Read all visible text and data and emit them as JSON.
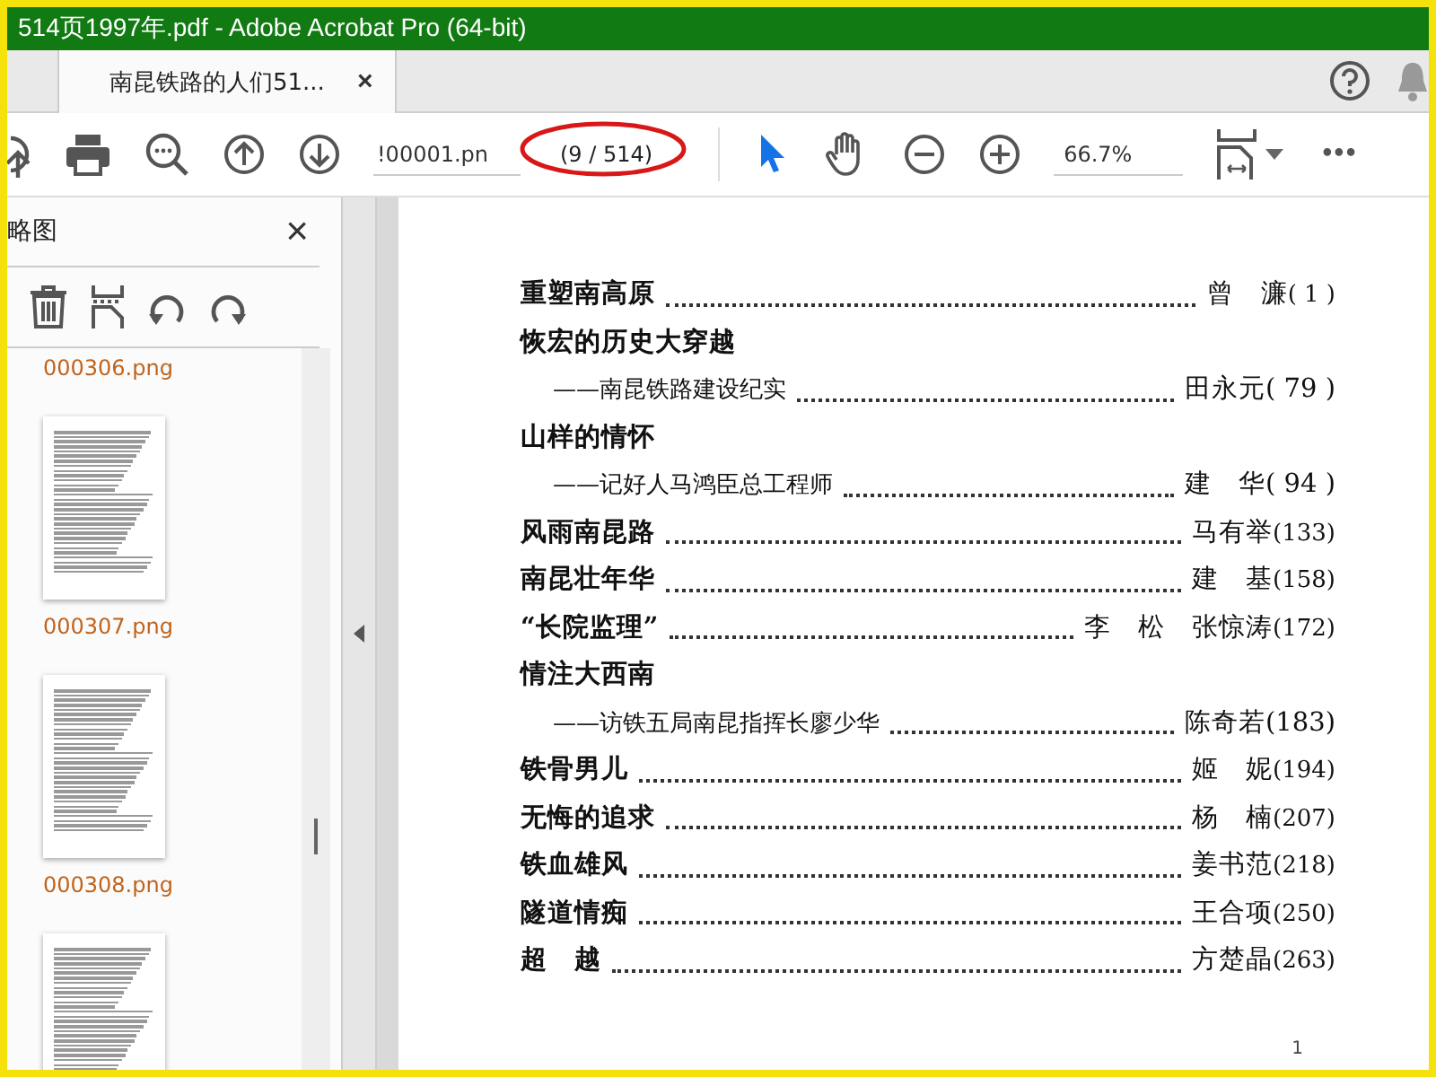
{
  "window": {
    "title": "514页1997年.pdf - Adobe Acrobat Pro (64-bit)"
  },
  "tabs": [
    {
      "label": "南昆铁路的人们51...",
      "selected": true,
      "close": "×"
    }
  ],
  "toolbar": {
    "page_field": "!00001.pn",
    "page_count": "(9 / 514)",
    "zoom": "66.7%",
    "more": "•••",
    "tools": [
      {
        "kind": "select",
        "selected": true
      },
      {
        "kind": "hand",
        "selected": false
      }
    ]
  },
  "sidebar": {
    "title": "略图",
    "close": "×",
    "thumbnails": [
      {
        "kind": "label",
        "label": "000306.png"
      },
      {
        "kind": "page",
        "label": "000307.png"
      },
      {
        "kind": "page",
        "label": "000308.png"
      },
      {
        "kind": "page"
      }
    ]
  },
  "document": {
    "entries": [
      {
        "kind": "entry",
        "title": "重塑南高原",
        "author": "曾　濂",
        "page": "( 1 )"
      },
      {
        "kind": "heading",
        "title": "恢宏的历史大穿越"
      },
      {
        "kind": "sub",
        "title": "——南昆铁路建设纪实",
        "author": "田永元",
        "page": "( 79 )"
      },
      {
        "kind": "heading",
        "title": "山样的情怀"
      },
      {
        "kind": "sub",
        "title": "——记好人马鸿臣总工程师",
        "author": "建　华",
        "page": "( 94 )"
      },
      {
        "kind": "entry",
        "title": "风雨南昆路",
        "author": "马有举",
        "page": "(133)"
      },
      {
        "kind": "entry",
        "title": "南昆壮年华",
        "author": "建　基",
        "page": "(158)"
      },
      {
        "kind": "entry",
        "title": "“长院监理”",
        "author": "李　松　张惊涛",
        "page": "(172)"
      },
      {
        "kind": "heading",
        "title": "情注大西南"
      },
      {
        "kind": "sub",
        "title": "——访铁五局南昆指挥长廖少华",
        "author": "陈奇若",
        "page": "(183)"
      },
      {
        "kind": "entry",
        "title": "铁骨男儿",
        "author": "姬　妮",
        "page": "(194)"
      },
      {
        "kind": "entry",
        "title": "无悔的追求",
        "author": "杨　楠",
        "page": "(207)"
      },
      {
        "kind": "entry",
        "title": "铁血雄风",
        "author": "姜书范",
        "page": "(218)"
      },
      {
        "kind": "entry",
        "title": "隧道情痴",
        "author": "王合项",
        "page": "(250)"
      },
      {
        "kind": "entry",
        "title": "超　越",
        "author": "方楚晶",
        "page": "(263)"
      }
    ],
    "page_number": "1"
  }
}
